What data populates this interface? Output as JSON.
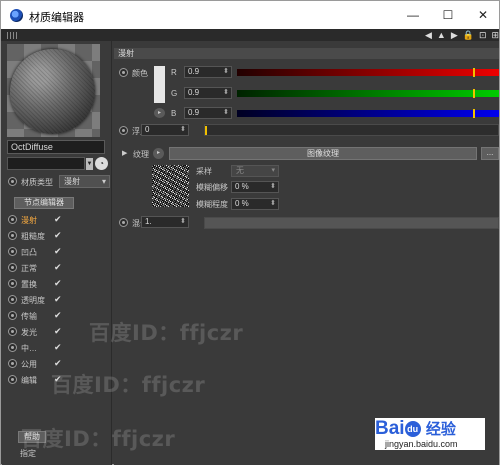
{
  "window": {
    "title": "材质编辑器",
    "min_glyph": "—",
    "max_glyph": "☐",
    "close_glyph": "✕"
  },
  "toolbar": {
    "icons": [
      "arrow-left-icon",
      "arrow-up-icon",
      "arrow-right-icon",
      "lock-icon",
      "pin-icon",
      "expand-icon"
    ]
  },
  "sidebar": {
    "material_name": "OctDiffuse",
    "material_type_label": "材质类型",
    "material_type_value": "漫射",
    "node_editor_label": "节点编辑器",
    "channels": [
      {
        "label": "漫射",
        "checked": true,
        "active": true
      },
      {
        "label": "粗糙度",
        "checked": true,
        "active": false
      },
      {
        "label": "凹凸",
        "checked": true,
        "active": false
      },
      {
        "label": "正常",
        "checked": true,
        "active": false
      },
      {
        "label": "置换",
        "checked": true,
        "active": false
      },
      {
        "label": "透明度",
        "checked": true,
        "active": false
      },
      {
        "label": "传输",
        "checked": true,
        "active": false
      },
      {
        "label": "发光",
        "checked": true,
        "active": false
      },
      {
        "label": "中…",
        "checked": true,
        "active": false
      },
      {
        "label": "公用",
        "checked": true,
        "active": false
      },
      {
        "label": "编辑",
        "checked": true,
        "active": false
      }
    ],
    "check_glyph": "✔",
    "help_label": "帮助",
    "assign_label": "指定"
  },
  "main": {
    "section_title": "漫射",
    "color_label": "颜色",
    "swatch_color": "#e6e6e6",
    "rgb": [
      {
        "channel": "R",
        "value": "0.9",
        "position": 0.9,
        "gradient": [
          "#220000",
          "#ee0000"
        ]
      },
      {
        "channel": "G",
        "value": "0.9",
        "position": 0.9,
        "gradient": [
          "#002200",
          "#00cc00"
        ]
      },
      {
        "channel": "B",
        "value": "0.9",
        "position": 0.9,
        "gradient": [
          "#000022",
          "#0000ee"
        ]
      }
    ],
    "float_label": "浮点",
    "float_value": "0",
    "texture_label": "纹理",
    "image_texture_label": "图像纹理",
    "more_label": "...",
    "sampling_label": "采样",
    "sampling_value": "无",
    "blur_offset_label": "模糊偏移",
    "blur_offset_value": "0 %",
    "blur_scale_label": "模糊程度",
    "blur_scale_value": "0 %",
    "mix_label": "混合",
    "mix_value": "1."
  },
  "watermarks": [
    "百度ID：ffjczr",
    "百度ID：ffjczr",
    "百度ID：ffjczr"
  ],
  "branding": {
    "logo_text_1": "Bai",
    "logo_paw": "du",
    "logo_text_2": "经验",
    "site": "jingyan.baidu.com"
  }
}
